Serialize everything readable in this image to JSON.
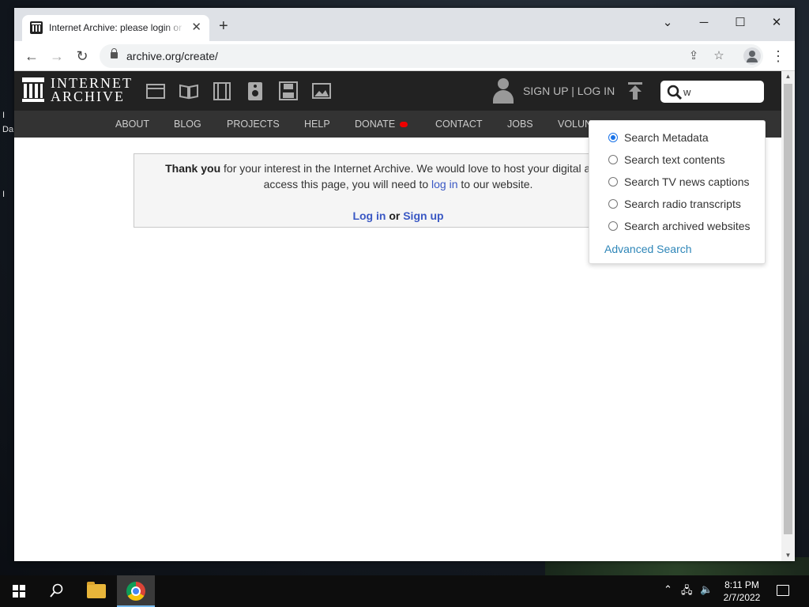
{
  "desktop": {
    "fragments": [
      "I",
      "Da",
      "I"
    ]
  },
  "browser": {
    "tab_title": "Internet Archive: please login or sign up",
    "tab_close": "✕",
    "new_tab": "+",
    "url": "archive.org/create/",
    "window_controls": {
      "minimize": "─",
      "maximize": "☐",
      "close": "✕",
      "tabs_menu": "⌄"
    }
  },
  "site": {
    "wordmark_line1": "INTERNET",
    "wordmark_line2": "ARCHIVE",
    "auth_link": "SIGN UP | LOG IN",
    "search": {
      "value": "w"
    },
    "media_icons": [
      "web-icon",
      "texts-icon",
      "video-icon",
      "audio-icon",
      "software-icon",
      "images-icon"
    ],
    "nav": [
      "ABOUT",
      "BLOG",
      "PROJECTS",
      "HELP",
      "DONATE",
      "CONTACT",
      "JOBS",
      "VOLUNTEER"
    ],
    "search_dropdown": {
      "options": [
        {
          "label": "Search Metadata",
          "selected": true
        },
        {
          "label": "Search text contents",
          "selected": false
        },
        {
          "label": "Search TV news captions",
          "selected": false
        },
        {
          "label": "Search radio transcripts",
          "selected": false
        },
        {
          "label": "Search archived websites",
          "selected": false
        }
      ],
      "advanced": "Advanced Search"
    },
    "notice": {
      "bold_lead": "Thank you",
      "line1_rest": " for your interest in the Internet Archive. We would love to host your digital artifacts! To",
      "line2_pre": "access this page, you will need to ",
      "line2_link": "log in",
      "line2_post": " to our website.",
      "login_link": "Log in",
      "or_text": " or ",
      "signup_link": "Sign up"
    }
  },
  "taskbar": {
    "time": "8:11 PM",
    "date": "2/7/2022"
  },
  "colors": {
    "ia_header": "#222222",
    "ia_nav": "#333333",
    "link": "#3a58c4",
    "advanced_link": "#2e86b8",
    "donate_dot": "#ee0000"
  }
}
